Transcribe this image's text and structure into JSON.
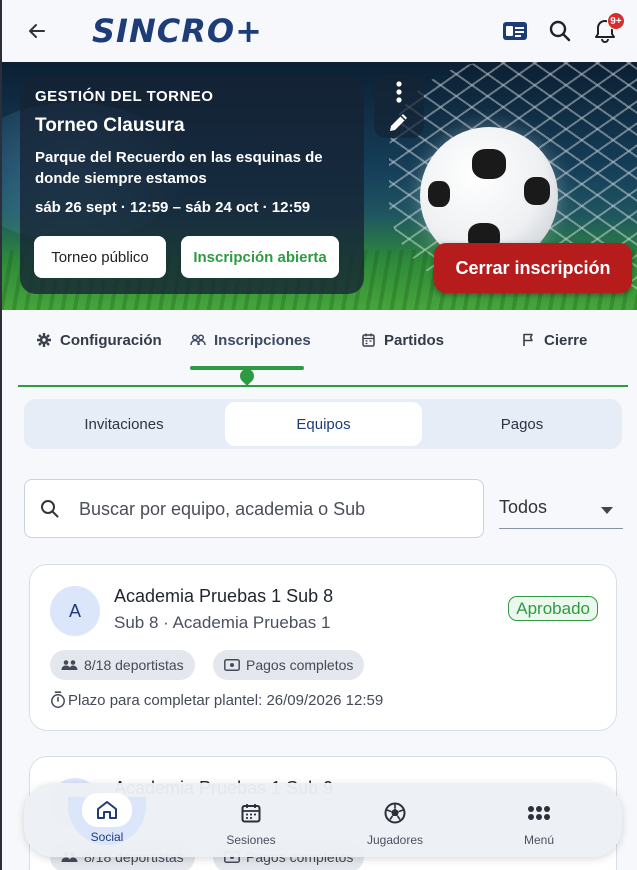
{
  "header": {
    "brand": "SINCRO+",
    "notifications_badge": "9+",
    "icons": {
      "back": "arrow-left-icon",
      "card": "id-card-icon",
      "search": "search-icon",
      "notifications": "bell-icon"
    }
  },
  "hero": {
    "kicker": "GESTIÓN DEL TORNEO",
    "title": "Torneo Clausura",
    "place": "Parque del Recuerdo en las esquinas de donde siempre estamos",
    "dates": "sáb 26 sept · 12:59 – sáb 24 oct · 12:59",
    "chip_public": "Torneo público",
    "chip_open": "Inscripción abierta",
    "close_button": "Cerrar inscripción",
    "icons": {
      "more": "more-vertical-icon",
      "edit": "pencil-icon"
    }
  },
  "tabs": [
    {
      "label": "Configuración",
      "icon": "gear-icon"
    },
    {
      "label": "Inscripciones",
      "icon": "people-icon"
    },
    {
      "label": "Partidos",
      "icon": "calendar-icon"
    },
    {
      "label": "Cierre",
      "icon": "flag-icon"
    }
  ],
  "active_tab": "Inscripciones",
  "segments": [
    "Invitaciones",
    "Equipos",
    "Pagos"
  ],
  "active_segment": "Equipos",
  "search": {
    "placeholder": "Buscar por equipo, academia o Sub"
  },
  "filter": {
    "selected": "Todos"
  },
  "teams": [
    {
      "initial": "A",
      "name": "Academia Pruebas 1 Sub 8",
      "sub": "Sub 8 · Academia Pruebas 1",
      "status": "Aprobado",
      "players": "8/18 deportistas",
      "payments": "Pagos completos",
      "deadline": "Plazo para completar plantel: 26/09/2026 12:59"
    },
    {
      "initial": "A",
      "name": "Academia Pruebas 1 Sub 9",
      "sub": "",
      "status": "",
      "players": "8/18 deportistas",
      "payments": "Pagos completos",
      "deadline": ""
    }
  ],
  "bottom_nav": [
    {
      "label": "Social",
      "icon": "home-icon"
    },
    {
      "label": "Sesiones",
      "icon": "calendar-icon"
    },
    {
      "label": "Jugadores",
      "icon": "soccer-ball-icon"
    },
    {
      "label": "Menú",
      "icon": "grid-dots-icon"
    }
  ],
  "active_nav": "Social",
  "colors": {
    "brand": "#1d3c78",
    "accent_green": "#2e9b43",
    "danger": "#b71c1c"
  }
}
